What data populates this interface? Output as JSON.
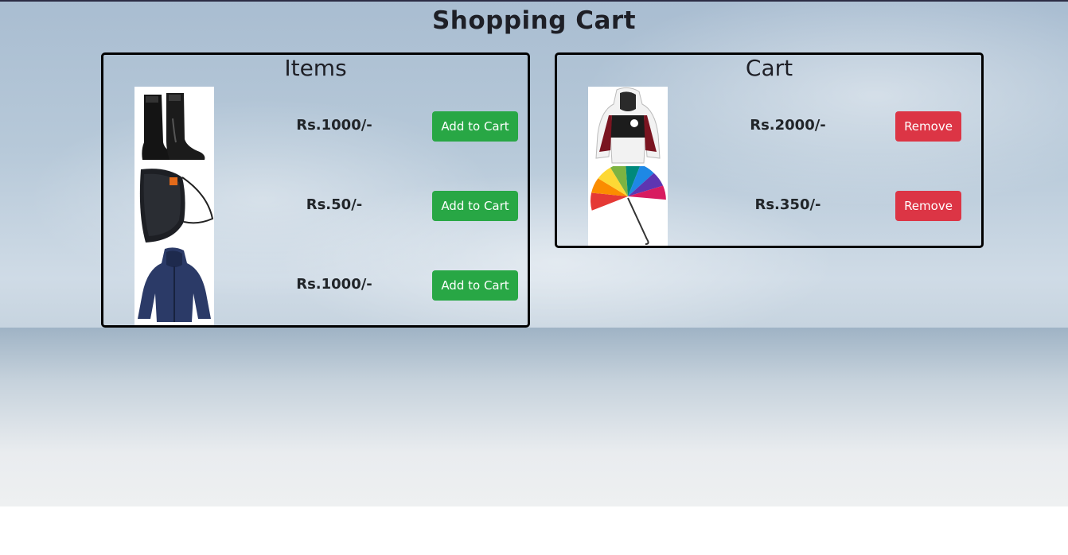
{
  "page": {
    "title": "Shopping Cart"
  },
  "items_panel": {
    "title": "Items",
    "products": [
      {
        "image_icon": "rubber-boots-icon",
        "price": "Rs.1000/-",
        "button_label": "Add to Cart"
      },
      {
        "image_icon": "face-mask-icon",
        "price": "Rs.50/-",
        "button_label": "Add to Cart"
      },
      {
        "image_icon": "rain-jacket-icon",
        "price": "Rs.1000/-",
        "button_label": "Add to Cart"
      }
    ]
  },
  "cart_panel": {
    "title": "Cart",
    "products": [
      {
        "image_icon": "hoodie-jacket-icon",
        "price": "Rs.2000/-",
        "button_label": "Remove"
      },
      {
        "image_icon": "umbrella-icon",
        "price": "Rs.350/-",
        "button_label": "Remove"
      }
    ]
  },
  "colors": {
    "add_button": "#28a745",
    "remove_button": "#dc3545",
    "panel_border": "#000000"
  }
}
